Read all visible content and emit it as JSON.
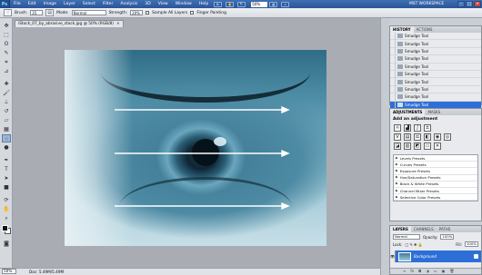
{
  "titlebar": {
    "logo": "Ps",
    "menu": [
      "File",
      "Edit",
      "Image",
      "Layer",
      "Select",
      "Filter",
      "Analysis",
      "3D",
      "View",
      "Window",
      "Help"
    ],
    "zoom": "50%",
    "workspace": "MST WORKSPACE"
  },
  "options": {
    "brush_label": "Brush:",
    "brush_size": "35",
    "mode_label": "Mode:",
    "mode_value": "Normal",
    "strength_label": "Strength:",
    "strength_value": "20%",
    "sample_all_layers": "Sample All Layers",
    "finger_painting": "Finger Painting"
  },
  "document": {
    "tab_title": "iStock_07_by_abrasive_stock.jpg @ 50% (RGB/8)",
    "tab_close": "×"
  },
  "status": {
    "zoom": "50%",
    "doc_size": "Doc: 5.49M/5.49M"
  },
  "history": {
    "tabs": [
      "HISTORY",
      "ACTIONS"
    ],
    "items": [
      "Smudge Tool",
      "Smudge Tool",
      "Smudge Tool",
      "Smudge Tool",
      "Smudge Tool",
      "Smudge Tool",
      "Smudge Tool",
      "Smudge Tool",
      "Smudge Tool",
      "Smudge Tool"
    ]
  },
  "adjustments": {
    "tabs": [
      "ADJUSTMENTS",
      "MASKS"
    ],
    "title": "Add an adjustment",
    "presets": [
      "Levels Presets",
      "Curves Presets",
      "Exposure Presets",
      "Hue/Saturation Presets",
      "Black & White Presets",
      "Channel Mixer Presets",
      "Selective Color Presets"
    ]
  },
  "layers": {
    "tabs": [
      "LAYERS",
      "CHANNELS",
      "PATHS"
    ],
    "blend_mode": "Normal",
    "opacity_label": "Opacity:",
    "opacity_value": "100%",
    "lock_label": "Lock:",
    "fill_label": "Fill:",
    "fill_value": "100%",
    "layer_name": "Background"
  },
  "colors": {
    "accent": "#2d6fd6",
    "titlebar": "#2a5698",
    "arrow": "#ffffff"
  }
}
